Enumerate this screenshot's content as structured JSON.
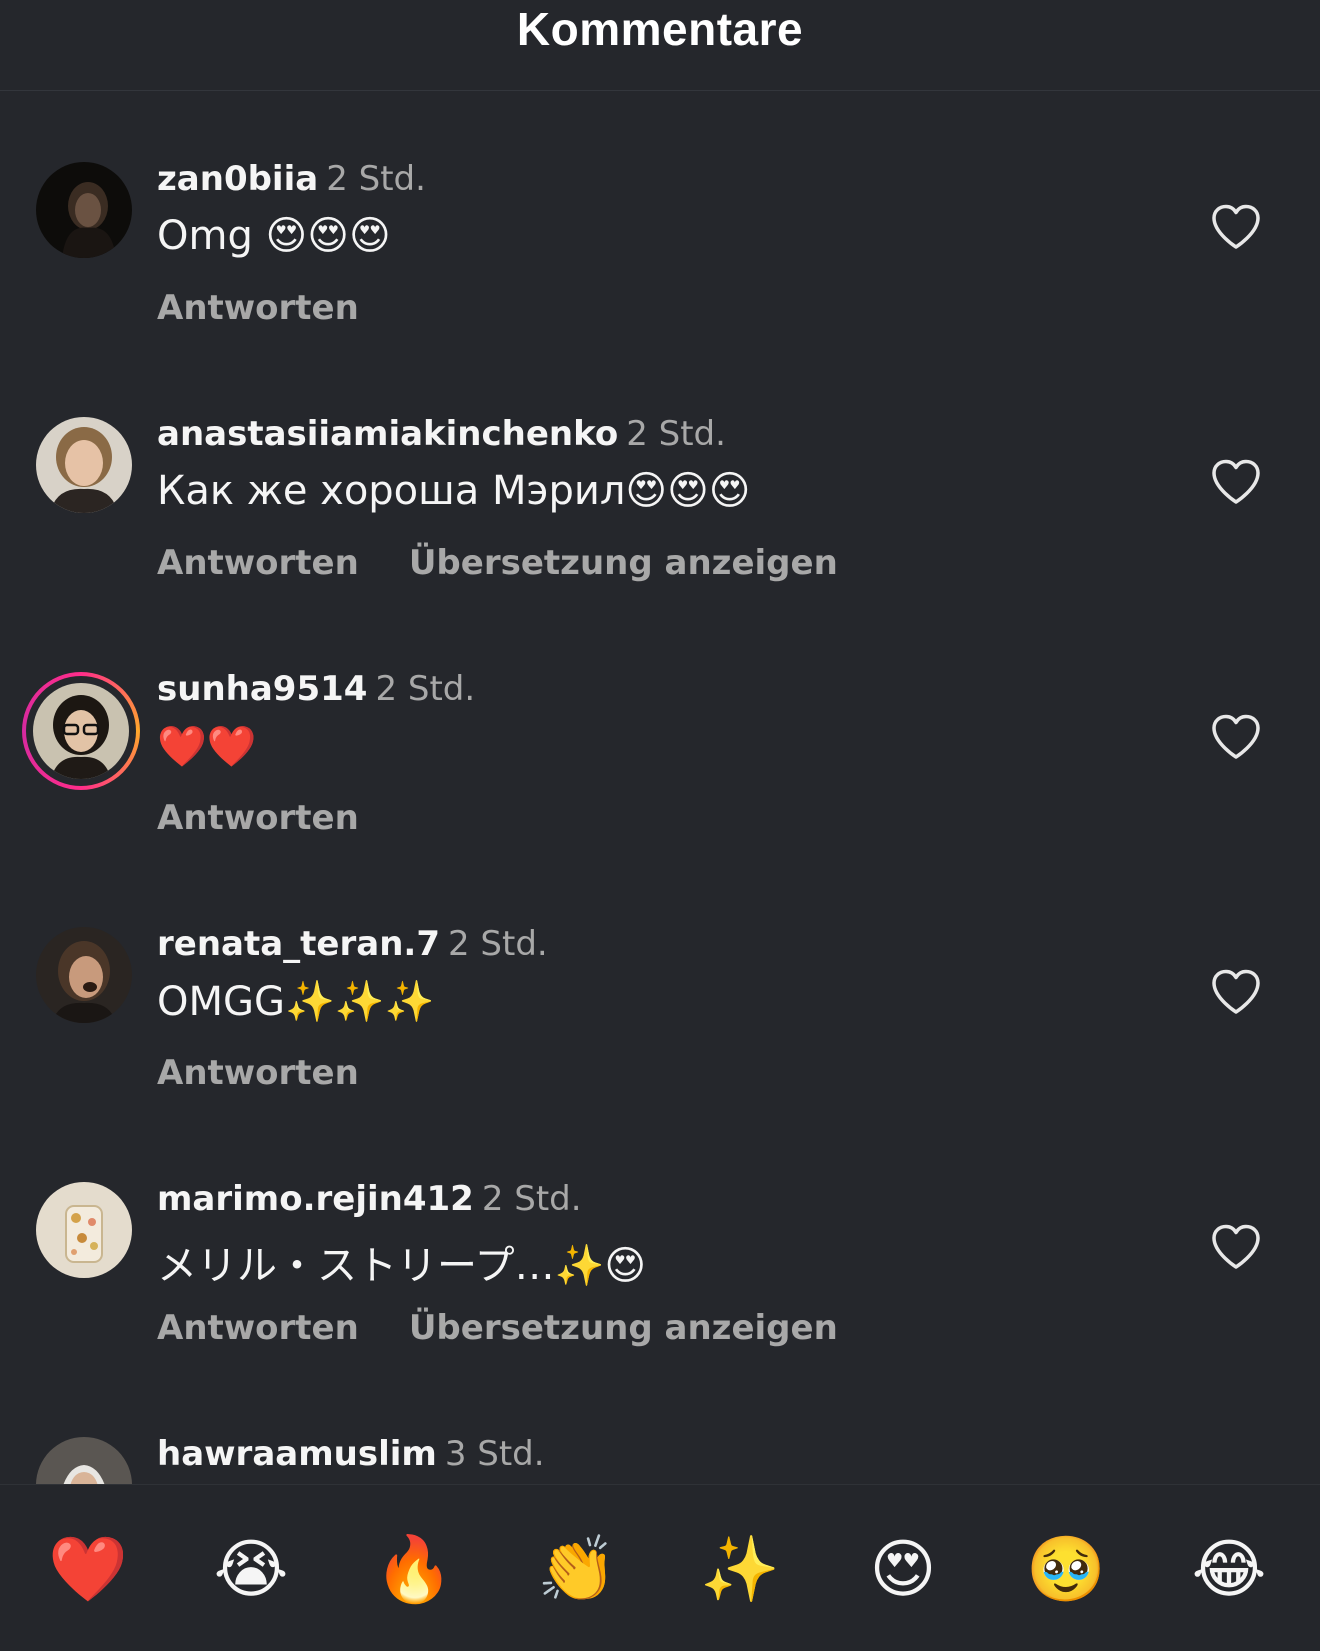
{
  "header": {
    "title": "Kommentare"
  },
  "comments": [
    {
      "username": "zan0biia",
      "time": "2 Std.",
      "text": "Omg 😍😍😍",
      "reply_label": "Antworten"
    },
    {
      "username": "anastasiiamiakinchenko",
      "time": "2 Std.",
      "text": "Как же хороша Мэрил😍😍😍",
      "reply_label": "Antworten",
      "translate_label": "Übersetzung anzeigen"
    },
    {
      "username": "sunha9514",
      "time": "2 Std.",
      "text": "❤️❤️",
      "reply_label": "Antworten"
    },
    {
      "username": "renata_teran.7",
      "time": "2 Std.",
      "text": "OMGG✨✨✨",
      "reply_label": "Antworten"
    },
    {
      "username": "marimo.rejin412",
      "time": "2 Std.",
      "text": "メリル・ストリープ…✨😍",
      "reply_label": "Antworten",
      "translate_label": "Übersetzung anzeigen"
    },
    {
      "username": "hawraamuslim",
      "time": "3 Std."
    }
  ],
  "reactions": [
    "❤️",
    "😭",
    "🔥",
    "👏",
    "✨",
    "😍",
    "🥹",
    "😂"
  ],
  "icons": {
    "like": "heart-outline-icon"
  },
  "colors": {
    "background": "#25272c",
    "text_primary": "#f5f5f5",
    "text_secondary": "#a8a8a8",
    "story_ring_start": "#ff2d8a",
    "story_ring_end": "#ffa82c"
  }
}
